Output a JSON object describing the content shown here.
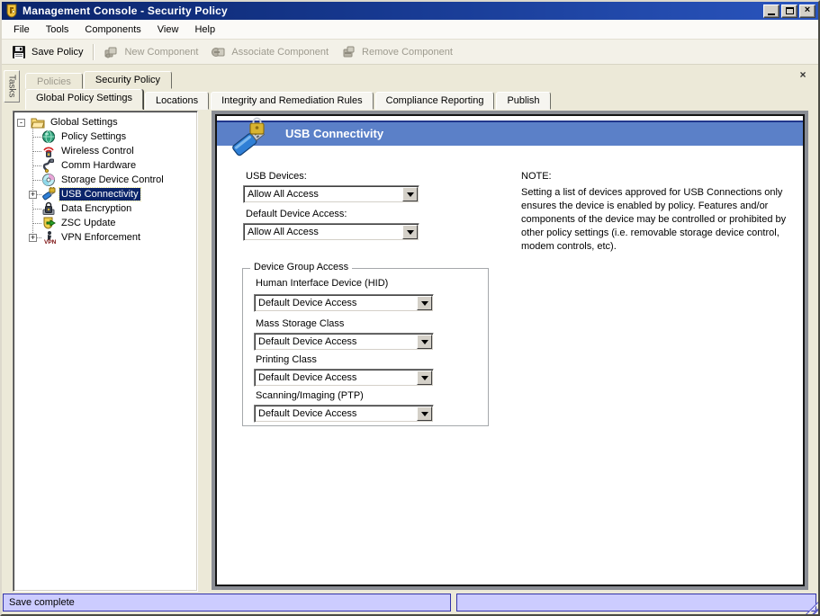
{
  "window": {
    "title": "Management Console - Security Policy",
    "close_glyph": "×"
  },
  "menu": {
    "items": [
      "File",
      "Tools",
      "Components",
      "View",
      "Help"
    ]
  },
  "toolbar": {
    "items": [
      {
        "label": "Save Policy",
        "enabled": true,
        "icon": "floppy-disk-icon"
      },
      {
        "label": "New Component",
        "enabled": false,
        "icon": "new-component-icon"
      },
      {
        "label": "Associate Component",
        "enabled": false,
        "icon": "associate-component-icon"
      },
      {
        "label": "Remove Component",
        "enabled": false,
        "icon": "remove-component-icon"
      }
    ]
  },
  "side_tab": {
    "label": "Tasks"
  },
  "tabs": {
    "close_glyph": "×",
    "level1": [
      {
        "label": "Policies",
        "state": "disabled"
      },
      {
        "label": "Security Policy",
        "state": "active"
      }
    ],
    "level2": [
      {
        "label": "Global Policy Settings",
        "state": "active"
      },
      {
        "label": "Locations",
        "state": "normal"
      },
      {
        "label": "Integrity and Remediation Rules",
        "state": "normal"
      },
      {
        "label": "Compliance Reporting",
        "state": "normal"
      },
      {
        "label": "Publish",
        "state": "normal"
      }
    ]
  },
  "tree": {
    "glyphs": {
      "plus": "+",
      "minus": "-"
    },
    "root": {
      "label": "Global Settings",
      "icon": "folder-open-icon",
      "expanded": true
    },
    "items": [
      {
        "label": "Policy Settings",
        "icon": "globe-icon"
      },
      {
        "label": "Wireless Control",
        "icon": "wireless-icon"
      },
      {
        "label": "Comm Hardware",
        "icon": "comm-hardware-icon"
      },
      {
        "label": "Storage Device Control",
        "icon": "storage-disk-icon"
      },
      {
        "label": "USB Connectivity",
        "icon": "usb-drive-icon",
        "selected": true,
        "has_children": true
      },
      {
        "label": "Data Encryption",
        "icon": "padlock-icon"
      },
      {
        "label": "ZSC Update",
        "icon": "shield-update-icon"
      },
      {
        "label": "VPN Enforcement",
        "icon": "vpn-icon",
        "has_children": true
      }
    ]
  },
  "content": {
    "header": {
      "title": "USB Connectivity",
      "icon": "usb-drive-lock-icon"
    },
    "fields": [
      {
        "label": "USB Devices:",
        "value": "Allow All Access"
      },
      {
        "label": "Default Device Access:",
        "value": "Allow All Access"
      }
    ],
    "group": {
      "title": "Device Group Access",
      "fields": [
        {
          "label": "Human Interface Device (HID)",
          "value": "Default Device Access"
        },
        {
          "label": "Mass Storage Class",
          "value": "Default Device Access"
        },
        {
          "label": "Printing Class",
          "value": "Default Device Access"
        },
        {
          "label": "Scanning/Imaging (PTP)",
          "value": "Default Device Access"
        }
      ]
    },
    "note": {
      "title": "NOTE:",
      "body": "Setting a list of devices approved for USB Connections only ensures the device is enabled by policy.  Features and/or components of the device may be controlled or prohibited by other policy settings (i.e. removable storage device control, modem controls, etc)."
    }
  },
  "status_bar": {
    "left": "Save complete",
    "right": ""
  },
  "colors": {
    "title_bar_start": "#0a246a",
    "title_bar_end": "#2a55be",
    "content_header": "#5b80c8",
    "status_bg": "#ccccff",
    "status_border": "#3333a8",
    "selection_bg": "#0a246a",
    "client_bg": "#ece9d8"
  }
}
